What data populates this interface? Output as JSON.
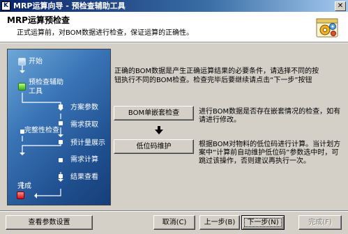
{
  "window": {
    "title": "MRP运算向导 - 预检查辅助工具",
    "app_icon": "K",
    "close_label": "✕"
  },
  "header": {
    "title": "MRP运算预检查",
    "subtitle": "正式运算前，对BOM数据进行检查，保证运算的正确性。",
    "icon": "gear-settings-icon"
  },
  "flow": {
    "steps": {
      "start": "开始",
      "precheck_line1": "预检查辅助",
      "precheck_line2": "工具",
      "plan_params": "方案参数",
      "demand_fetch": "需求获取",
      "integrity_check": "完整性检查",
      "plan_display": "预计量展示",
      "demand_calc": "需求计算",
      "result_view": "结果查看",
      "finish": "完成"
    }
  },
  "intro": {
    "line1": "正确的BOM数据是产生正确运算结果的必要条件，请选择不同的按",
    "line2": "钮执行不同的BOM检查。检查完毕后要继续请点击“下一步”按钮"
  },
  "actions": {
    "bom_nesting_button": "BOM单嵌套检查",
    "bom_nesting_desc_line1": "进行BOM数据是否存在嵌套情况的检查，如有",
    "bom_nesting_desc_line2": "请进行修改。",
    "low_level_button": "低位码维护",
    "low_level_desc_line1": "根据BOM对物料的低位码进行计算。当计划方",
    "low_level_desc_line2": "案中“计算前自动维护低位码”参数选中时，可",
    "low_level_desc_line3": "跳过该操作，否则建议再执行一次。"
  },
  "footer": {
    "view_params": "查看参数设置",
    "cancel": "取消(C)",
    "prev": "上一步(B)",
    "next": "下一步(N)",
    "finish": "完成(F)"
  }
}
